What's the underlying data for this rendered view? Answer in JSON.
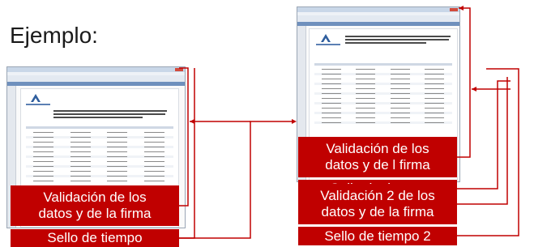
{
  "title": "Ejemplo:",
  "left_stack": {
    "validation_box": {
      "line1": "Validación de los",
      "line2": "datos y de la firma"
    },
    "timestamp_box": "Sello de tiempo"
  },
  "right_stack": {
    "validation_box": {
      "line1": "Validación de los",
      "line2": "datos y de l firma"
    },
    "timestamp_box": "Sello de tiempo",
    "validation2_box": {
      "line1": "Validación 2 de los",
      "line2": "datos y de la firma"
    },
    "timestamp2_box": "Sello de tiempo 2"
  },
  "colors": {
    "box_fill": "#c00000",
    "box_text": "#ffffff",
    "connector": "#c00000"
  }
}
